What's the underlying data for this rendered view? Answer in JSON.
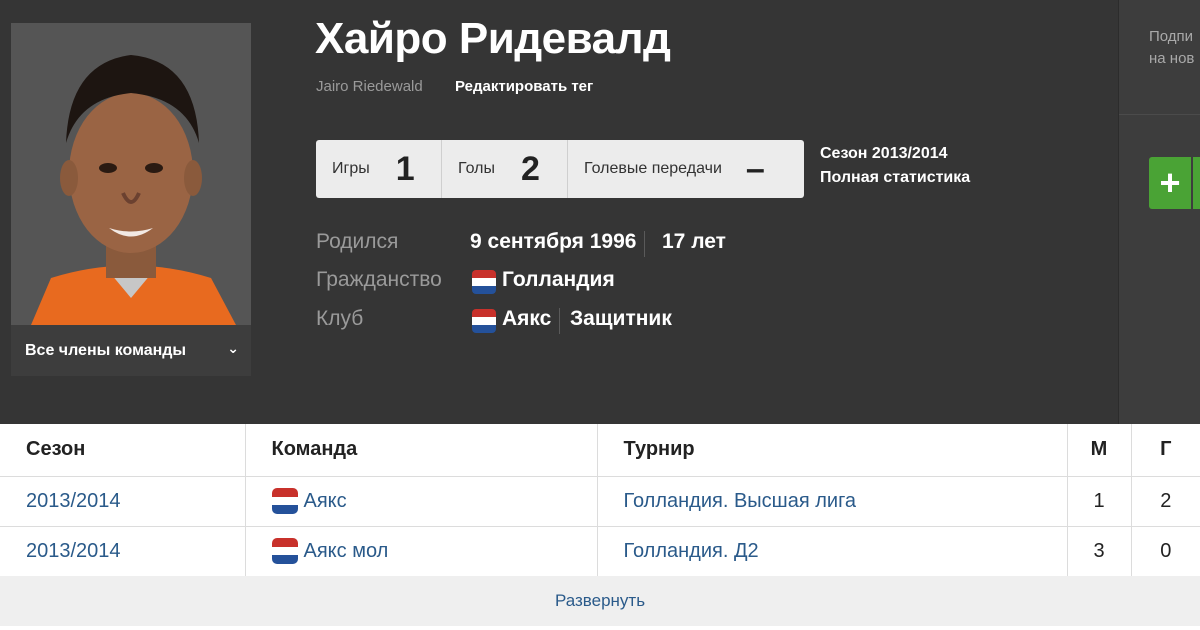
{
  "player": {
    "name": "Хайро Ридевалд",
    "latin_name": "Jairo Riedewald",
    "edit_tag": "Редактировать тег",
    "team_members_label": "Все члены команды"
  },
  "stats": [
    {
      "label": "Игры",
      "value": "1"
    },
    {
      "label": "Голы",
      "value": "2"
    },
    {
      "label": "Голевые передачи",
      "value": "–"
    }
  ],
  "season": {
    "label": "Сезон 2013/2014",
    "full_stats": "Полная статистика"
  },
  "info": {
    "born_label": "Родился",
    "born_value": "9 сентября 1996",
    "age": "17 лет",
    "citizenship_label": "Гражданство",
    "citizenship_value": "Голландия",
    "club_label": "Клуб",
    "club_value": "Аякс",
    "position": "Защитник"
  },
  "side_panel": {
    "subscribe_line1": "Подпи",
    "subscribe_line2": "на нов",
    "plus": "+"
  },
  "table": {
    "headers": [
      "Сезон",
      "Команда",
      "Турнир",
      "М",
      "Г"
    ],
    "rows": [
      [
        "2013/2014",
        "Аякс",
        "Голландия. Высшая лига",
        "1",
        "2"
      ],
      [
        "2013/2014",
        "Аякс мол",
        "Голландия. Д2",
        "3",
        "0"
      ]
    ],
    "expand": "Развернуть"
  },
  "colors": {
    "flag_red": "#c8312b",
    "flag_white": "#ffffff",
    "flag_blue": "#24519a",
    "link": "#2a5a8a",
    "accent_green": "#4aa335"
  }
}
